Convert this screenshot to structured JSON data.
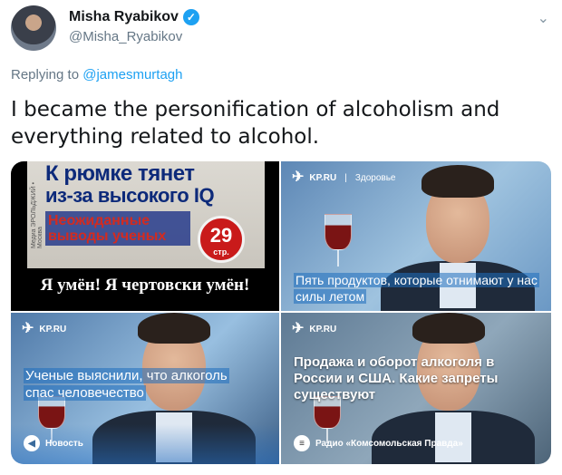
{
  "author": {
    "name": "Misha Ryabikov",
    "handle": "@Misha_Ryabikov"
  },
  "reply": {
    "prefix": "Replying to ",
    "mention": "@jamesmurtagh"
  },
  "tweet": {
    "text": "I became the personification of alcoholism and everything related to alcohol."
  },
  "media": {
    "tile1": {
      "headline1": "К рюмке тянет",
      "headline2": "из-за высокого IQ",
      "subhead": "Неожиданные выводы ученых",
      "badge_number": "29",
      "badge_unit": "стр.",
      "side_text": "Медиа ЭРОЛЬДЖИЙ • Москва",
      "caption": "Я умён! Я чертовски умён!"
    },
    "tile2": {
      "brand": "KP.RU",
      "category": "Здоровье",
      "caption": "Пять продуктов, которые отнимают у нас силы летом"
    },
    "tile3": {
      "brand": "KP.RU",
      "caption": "Ученые выяснили, что алкоголь спас человечество",
      "footer": "Новость"
    },
    "tile4": {
      "brand": "KP.RU",
      "caption": "Продажа и оборот алкоголя в России и США. Какие запреты существуют",
      "footer": "Радио «Комсомольская Правда»"
    }
  },
  "icons": {
    "verified": "verified-badge-icon",
    "menu": "chevron-down-icon",
    "brand": "kp-logo-icon"
  },
  "colors": {
    "link": "#1da1f2",
    "muted": "#657786",
    "verified": "#1da1f2"
  }
}
